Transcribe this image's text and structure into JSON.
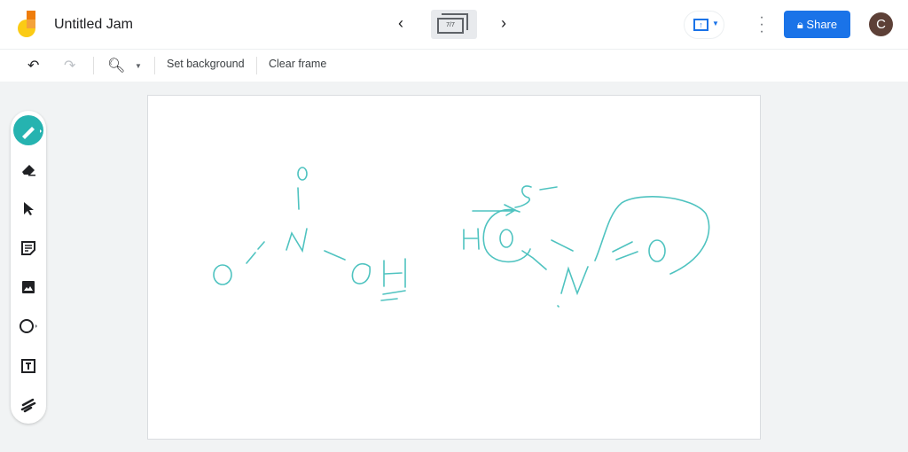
{
  "header": {
    "title": "Untitled Jam",
    "frame_indicator": "7/7",
    "share_label": "Share",
    "avatar_initial": "C"
  },
  "toolbar": {
    "set_background": "Set background",
    "clear_frame": "Clear frame"
  },
  "colors": {
    "pen": "#4fc3c0",
    "accent": "#1a73e8",
    "tool_active": "#26b3b0"
  },
  "drawing": {
    "handwritten_labels": [
      "O",
      "N",
      "O",
      "OH",
      "H",
      "O",
      "S",
      "N",
      "O"
    ]
  }
}
